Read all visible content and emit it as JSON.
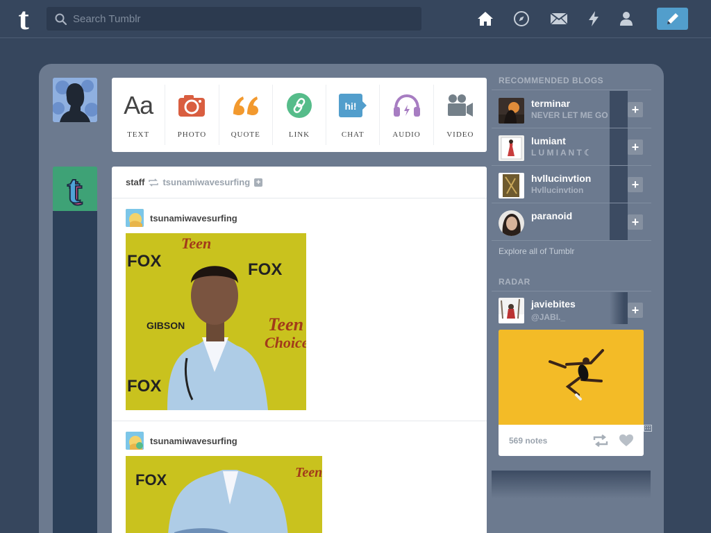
{
  "topbar": {
    "search_placeholder": "Search Tumblr"
  },
  "post_types": [
    {
      "label": "TEXT",
      "icon": "text-icon"
    },
    {
      "label": "PHOTO",
      "icon": "camera-icon"
    },
    {
      "label": "QUOTE",
      "icon": "quote-icon"
    },
    {
      "label": "LINK",
      "icon": "link-icon"
    },
    {
      "label": "CHAT",
      "icon": "chat-icon"
    },
    {
      "label": "AUDIO",
      "icon": "headphones-icon"
    },
    {
      "label": "VIDEO",
      "icon": "video-camera-icon"
    }
  ],
  "post": {
    "reblogger": "staff",
    "source": "tsunamiwavesurfing",
    "entries": [
      {
        "username": "tsunamiwavesurfing"
      },
      {
        "username": "tsunamiwavesurfing"
      }
    ]
  },
  "recommended": {
    "title": "RECOMMENDED BLOGS",
    "blogs": [
      {
        "name": "terminar",
        "subtitle": "NEVER LET ME GO"
      },
      {
        "name": "lumiant",
        "subtitle": "L U M I A N T ☾"
      },
      {
        "name": "hvllucinvtion",
        "subtitle": "Hvllucinvtion"
      },
      {
        "name": "paranoid",
        "subtitle": ""
      }
    ],
    "explore": "Explore all of Tumblr"
  },
  "radar": {
    "title": "RADAR",
    "blog": {
      "name": "javiebites",
      "subtitle": "@JABI._"
    },
    "notes": "569 notes"
  },
  "colors": {
    "background": "#36465d",
    "panel": "#6c7a8f",
    "accent": "#529ecc"
  }
}
